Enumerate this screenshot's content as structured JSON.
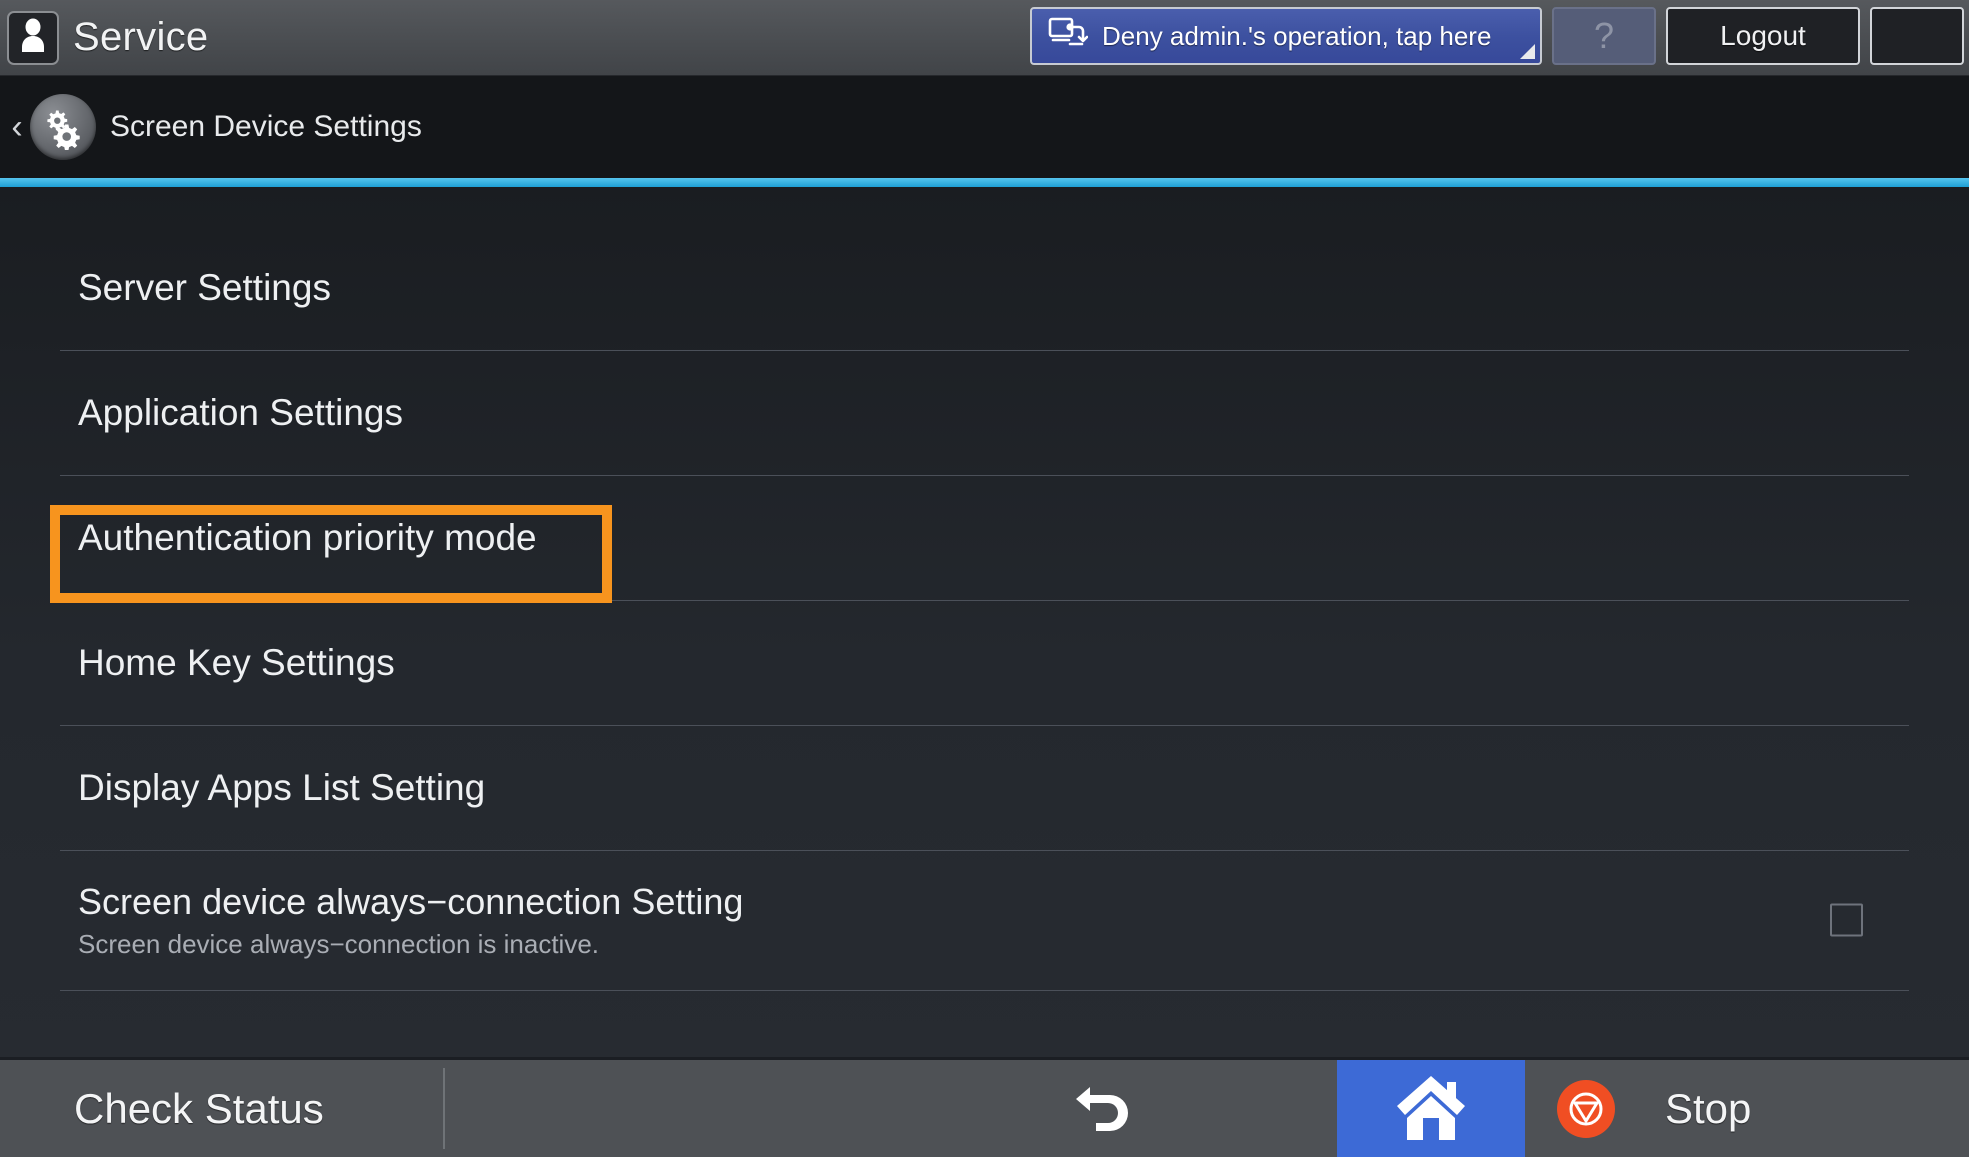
{
  "topbar": {
    "user_icon": "person-icon",
    "app_title": "Service",
    "notice_button": {
      "icon": "remote-screen-icon",
      "label": "Deny admin.'s operation, tap here"
    },
    "help_label": "?",
    "logout_label": "Logout",
    "sleep_icon": "crescent-moon-icon"
  },
  "breadcrumb": {
    "back_icon": "chevron-left-icon",
    "page_icon": "gears-icon",
    "title": "Screen Device Settings",
    "accent_color": "#2aa8e0"
  },
  "list": {
    "items": [
      {
        "title": "Server Settings",
        "subtitle": "",
        "checkbox": false
      },
      {
        "title": "Application Settings",
        "subtitle": "",
        "checkbox": false
      },
      {
        "title": "Authentication priority mode",
        "subtitle": "",
        "checkbox": false
      },
      {
        "title": "Home Key Settings",
        "subtitle": "",
        "checkbox": false
      },
      {
        "title": "Display Apps List Setting",
        "subtitle": "",
        "checkbox": false
      },
      {
        "title": "Screen device always−connection Setting",
        "subtitle": "Screen device always−connection is inactive.",
        "checkbox": true
      }
    ],
    "highlight": {
      "target": "Authentication priority mode",
      "color": "#f7941e"
    }
  },
  "bottombar": {
    "check_status_label": "Check Status",
    "back_icon": "undo-arrow-icon",
    "home_icon": "home-icon",
    "home_color": "#3d6ad6",
    "stop_icon": "stop-circle-icon",
    "stop_color": "#f04e23",
    "stop_label": "Stop"
  }
}
